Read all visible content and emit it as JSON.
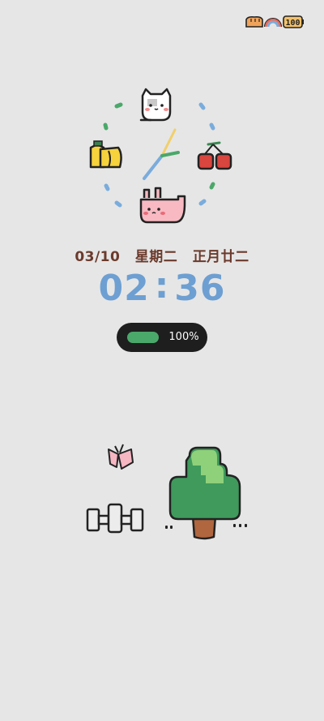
{
  "status_bar": {
    "icons": [
      "bread-icon",
      "rainbow-icon",
      "battery-icon"
    ],
    "battery_label": "100"
  },
  "clock": {
    "hour_hand_color": "#7aacdc",
    "minute_hand_color": "#f2cf6a",
    "second_hand_color": "#4aa86a",
    "tick_colors": [
      "#4aa86a",
      "#7aacdc"
    ],
    "markers": [
      "cat-icon",
      "cherry-icon",
      "bunny-icon",
      "banana-icon"
    ]
  },
  "date": {
    "day": "03/10",
    "weekday": "星期二",
    "lunar": "正月廿二"
  },
  "time": {
    "hours": "02",
    "separator": ":",
    "minutes": "36"
  },
  "battery": {
    "level": 1.0,
    "label": "100%",
    "bar_color": "#4aa86a"
  },
  "scene": {
    "items": [
      "butterfly-icon",
      "barbell-icon",
      "tree-icon",
      "grass-dots"
    ]
  },
  "colors": {
    "background": "#e6e6e6",
    "date_text": "#6b3a2c",
    "time_text": "#6d9fd2"
  }
}
